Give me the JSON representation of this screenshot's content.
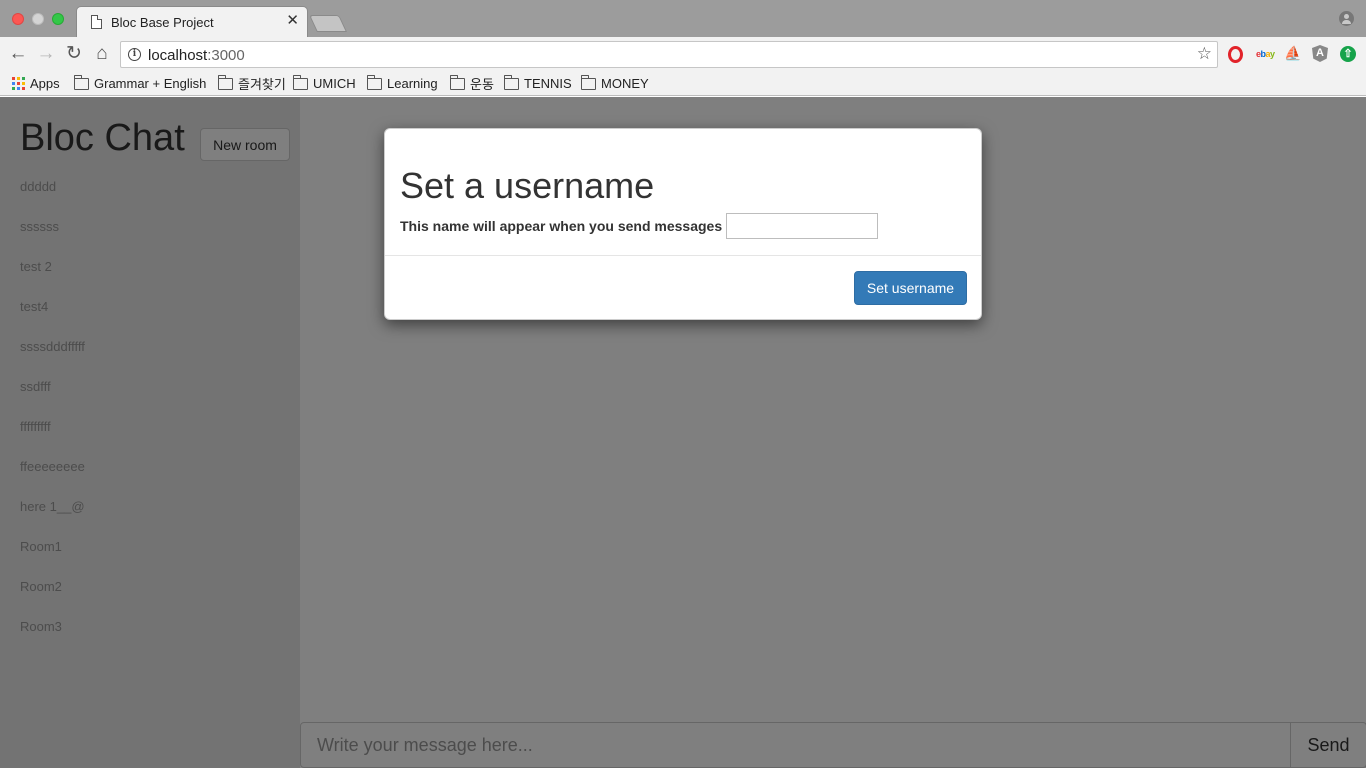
{
  "browser": {
    "tab_title": "Bloc Base Project",
    "tab_close": "✕",
    "url_host": "localhost",
    "url_port": ":3000",
    "bookmarks": [
      {
        "label": "Apps",
        "type": "apps"
      },
      {
        "label": "Grammar + English",
        "type": "folder"
      },
      {
        "label": "즐겨찾기",
        "type": "folder"
      },
      {
        "label": "UMICH",
        "type": "folder"
      },
      {
        "label": "Learning",
        "type": "folder"
      },
      {
        "label": "운동",
        "type": "folder"
      },
      {
        "label": "TENNIS",
        "type": "folder"
      },
      {
        "label": "MONEY",
        "type": "folder"
      }
    ],
    "icons": {
      "back": "back-arrow-icon",
      "forward": "forward-arrow-icon",
      "reload": "reload-icon",
      "home": "home-icon",
      "info": "info-icon",
      "star": "star-icon",
      "extensions": [
        "opera-icon",
        "ebay-icon",
        "ship-icon",
        "angular-icon",
        "update-icon"
      ],
      "profile": "profile-icon"
    }
  },
  "app": {
    "title": "Bloc Chat",
    "new_room_label": "New room",
    "rooms": [
      "ddddd",
      "ssssss",
      "test 2",
      "test4",
      "ssssdddfffff",
      "ssdfff",
      "fffffffff",
      "ffeeeeeeee",
      "here 1__@",
      "Room1",
      "Room2",
      "Room3"
    ],
    "message_placeholder": "Write your message here...",
    "send_label": "Send"
  },
  "modal": {
    "title": "Set a username",
    "label": "This name will appear when you send messages",
    "input_value": "",
    "submit_label": "Set username"
  },
  "colors": {
    "primary": "#337ab7",
    "sidebar_bg": "#e6e6e6",
    "backdrop": "rgba(0,0,0,0.5)"
  }
}
